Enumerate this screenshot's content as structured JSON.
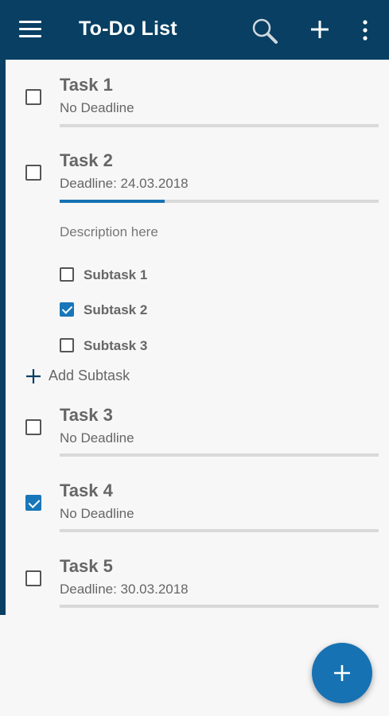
{
  "appbar": {
    "title": "To-Do List",
    "icons": [
      "menu-icon",
      "search-icon",
      "add-icon",
      "more-vert-icon"
    ],
    "color": "#083f63"
  },
  "tasks": [
    {
      "title": "Task 1",
      "deadline": "No Deadline",
      "checked": false,
      "progress": 0
    },
    {
      "title": "Task 2",
      "deadline": "Deadline: 24.03.2018",
      "checked": false,
      "progress": 0.33,
      "description": "Description here",
      "subtasks": [
        {
          "label": "Subtask 1",
          "checked": false
        },
        {
          "label": "Subtask 2",
          "checked": true
        },
        {
          "label": "Subtask 3",
          "checked": false
        }
      ],
      "add_subtask_label": "Add Subtask"
    },
    {
      "title": "Task 3",
      "deadline": "No Deadline",
      "checked": false,
      "progress": 0
    },
    {
      "title": "Task 4",
      "deadline": "No Deadline",
      "checked": true,
      "progress": 0
    },
    {
      "title": "Task 5",
      "deadline": "Deadline: 30.03.2018",
      "checked": false,
      "progress": 0
    }
  ],
  "fab": {
    "icon": "add-icon",
    "color": "#1672b3"
  }
}
